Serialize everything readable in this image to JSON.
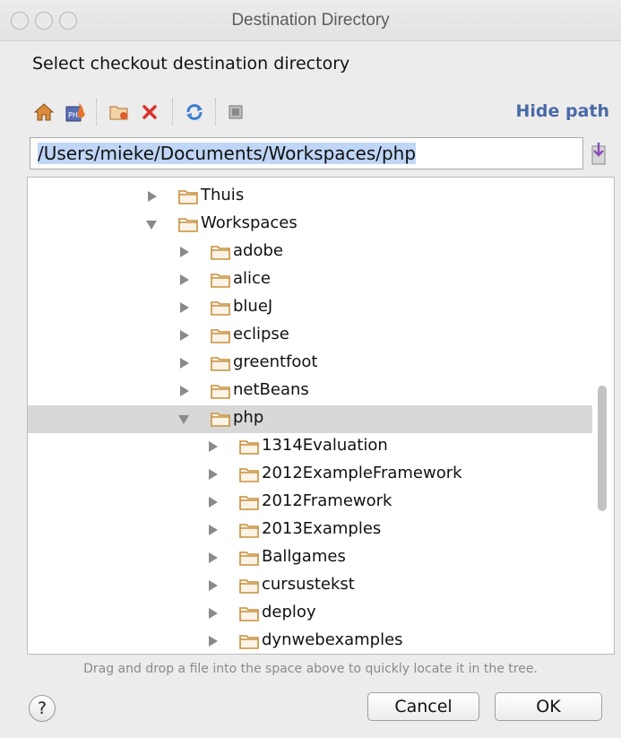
{
  "window": {
    "title": "Destination Directory"
  },
  "prompt": "Select checkout destination directory",
  "toolbar": {
    "icons": [
      "home-icon",
      "php-project-icon",
      "new-folder-icon",
      "delete-icon",
      "refresh-icon",
      "show-hidden-icon"
    ],
    "hide_path_label": "Hide path"
  },
  "path": {
    "value": "/Users/mieke/Documents/Workspaces/php"
  },
  "tree": {
    "rows": [
      {
        "label": "Thuis",
        "expanded": false,
        "selected": false
      },
      {
        "label": "Workspaces",
        "expanded": true,
        "selected": false
      },
      {
        "label": "adobe",
        "expanded": false,
        "selected": false
      },
      {
        "label": "alice",
        "expanded": false,
        "selected": false
      },
      {
        "label": "blueJ",
        "expanded": false,
        "selected": false
      },
      {
        "label": "eclipse",
        "expanded": false,
        "selected": false
      },
      {
        "label": "greentfoot",
        "expanded": false,
        "selected": false
      },
      {
        "label": "netBeans",
        "expanded": false,
        "selected": false
      },
      {
        "label": "php",
        "expanded": true,
        "selected": true
      },
      {
        "label": "1314Evaluation",
        "expanded": false,
        "selected": false
      },
      {
        "label": "2012ExampleFramework",
        "expanded": false,
        "selected": false
      },
      {
        "label": "2012Framework",
        "expanded": false,
        "selected": false
      },
      {
        "label": "2013Examples",
        "expanded": false,
        "selected": false
      },
      {
        "label": "Ballgames",
        "expanded": false,
        "selected": false
      },
      {
        "label": "cursustekst",
        "expanded": false,
        "selected": false
      },
      {
        "label": "deploy",
        "expanded": false,
        "selected": false
      },
      {
        "label": "dynwebexamples",
        "expanded": false,
        "selected": false
      }
    ]
  },
  "hint": "Drag and drop a file into the space above to quickly locate it in the tree.",
  "buttons": {
    "help": "?",
    "cancel": "Cancel",
    "ok": "OK"
  },
  "colors": {
    "accent": "#4a6aa8",
    "folder": "#c7913f",
    "selection": "#d8d8d8"
  }
}
